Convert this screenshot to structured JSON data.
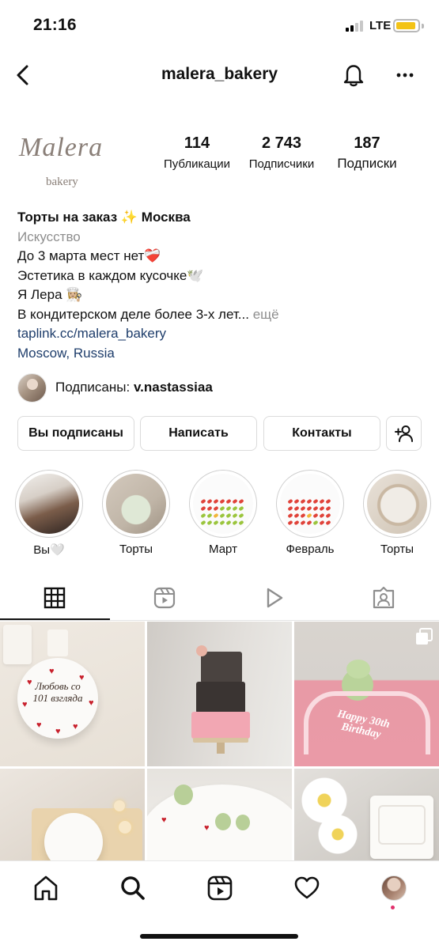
{
  "status_bar": {
    "time": "21:16",
    "network": "LTE",
    "battery_color": "#f3c316"
  },
  "header": {
    "username": "malera_bakery",
    "back_icon": "chevron-left-icon",
    "notifications_icon": "bell-icon",
    "more_icon": "more-horizontal-icon"
  },
  "profile": {
    "logo_text": "Malera",
    "logo_subtext": "bakery",
    "stats": [
      {
        "value": "114",
        "label": "Публикации"
      },
      {
        "value": "2 743",
        "label": "Подписчики"
      },
      {
        "value": "187",
        "label": "Подписки"
      }
    ]
  },
  "bio": {
    "name": "Торты на заказ ✨ Москва",
    "category": "Искусство",
    "lines": [
      "До 3 марта мест нет❤️‍🩹",
      "Эстетика в каждом кусочке🕊️",
      "Я Лера 👩🏼‍🍳",
      "В кондитерском деле более 3-х лет..."
    ],
    "more": "ещё",
    "link": "taplink.cc/malera_bakery",
    "location": "Moscow, Russia"
  },
  "followed_by": {
    "prefix": "Подписаны: ",
    "user": "v.nastassiaa"
  },
  "actions": {
    "following": "Вы подписаны",
    "message": "Написать",
    "contacts": "Контакты",
    "add_user_icon": "add-user-icon"
  },
  "highlights": [
    {
      "label": "Вы🤍"
    },
    {
      "label": "Торты"
    },
    {
      "label": "Март"
    },
    {
      "label": "Февраль"
    },
    {
      "label": "Торты"
    }
  ],
  "tabs": [
    {
      "icon": "grid-icon",
      "active": true
    },
    {
      "icon": "reels-icon",
      "active": false
    },
    {
      "icon": "play-icon",
      "active": false
    },
    {
      "icon": "tagged-icon",
      "active": false
    }
  ],
  "posts": {
    "post1_text": "Любовь со 101 взгляда",
    "post3_text": "Happy 30th Birthday"
  },
  "bottom_nav": [
    {
      "icon": "home-icon"
    },
    {
      "icon": "search-icon"
    },
    {
      "icon": "reels-icon"
    },
    {
      "icon": "heart-icon"
    },
    {
      "icon": "profile-avatar"
    }
  ]
}
